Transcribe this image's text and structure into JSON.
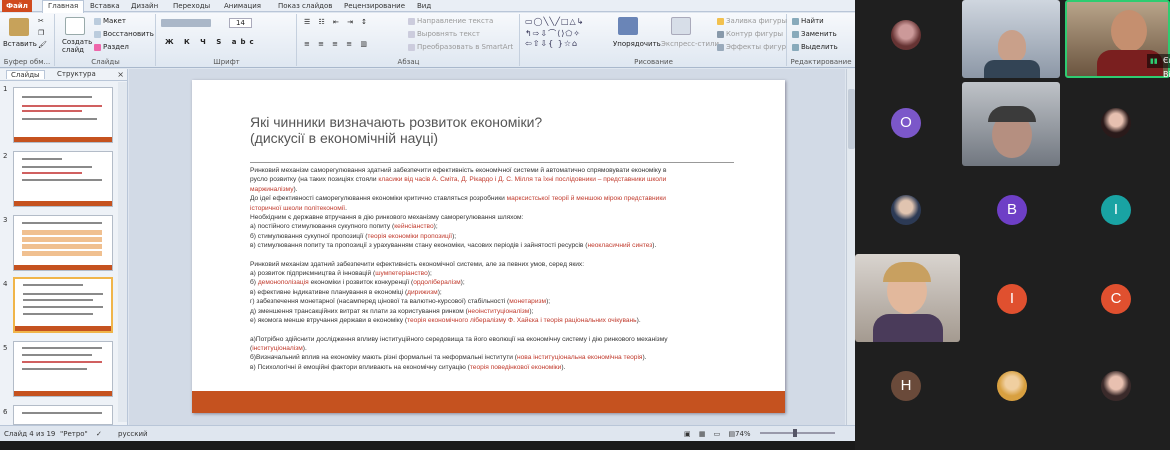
{
  "ribbon": {
    "file_tab": "Файл",
    "tabs": [
      "Главная",
      "Вставка",
      "Дизайн",
      "Переходы",
      "Анимация",
      "Показ слайдов",
      "Рецензирование",
      "Вид"
    ],
    "groups": {
      "clipboard": "Буфер обм...",
      "slides": "Слайды",
      "font": "Шрифт",
      "paragraph": "Абзац",
      "drawing": "Рисование",
      "editing": "Редактирование"
    },
    "paste": "Вставить",
    "new_slide": "Создать слайд",
    "layout": "Макет",
    "reset": "Восстановить",
    "section": "Раздел",
    "font_size": "14",
    "text_direction": "Направление текста",
    "align_text": "Выровнять текст",
    "smartart": "Преобразовать в SmartArt",
    "arrange": "Упорядочить",
    "quick_styles": "Экспресс-стили",
    "shape_fill": "Заливка фигуры",
    "shape_outline": "Контур фигуры",
    "shape_effects": "Эффекты фигур",
    "find": "Найти",
    "replace": "Заменить",
    "select": "Выделить"
  },
  "panel": {
    "tab_slides": "Слайды",
    "tab_outline": "Структура",
    "close": "×",
    "slide_numbers": [
      "1",
      "2",
      "3",
      "4",
      "5",
      "6"
    ]
  },
  "slide": {
    "title_line1": "Які чинники визначають розвиток економіки?",
    "title_line2": "(дискусії в економічній науці)",
    "p1a": "Ринковий механізм саморегулювання здатний забезпечити ефективність економічної системи й автоматично спрямовувати економіку в",
    "p1b_pre": "русло розвитку (на таких позиціях стояли ",
    "p1b_red": "класики від часів А. Сміта, Д. Рікардо і  Д. С. Мілля та їхні послідовники – представники школи",
    "p1c_red": "маржиналізму",
    "p1c_post": ").",
    "p2a_pre": "До  ідеї ефективності саморегулювання економіки критично ставляться розробники ",
    "p2a_red": "марксистської  теорії й меншою мірою представники",
    "p2b_red": "історичної школи політекономії",
    "p2b_post": ".",
    "p3": "Необхідним є державне втручання в дію ринкового механізму саморегулювання шляхом:",
    "p3a_pre": "а) постійного стимулювання сукупного попиту (",
    "p3a_red": "кейнсіанство",
    "p3a_post": ");",
    "p3b_pre": "б) стимулювання сукупної пропозиції (",
    "p3b_red": "теорія економіки пропозиції",
    "p3b_post": ");",
    "p3c_pre": "в) стимулювання  попиту та пропозиції з урахуванням стану економіки, часових періодів і зайнятості ресурсів (",
    "p3c_red": "неокласичний синтез",
    "p3c_post": ").",
    "p4": "Ринковий механізм здатний забезпечити ефективність економічної системи, але за певних умов, серед яких:",
    "p4a_pre": "а) розвиток підприємництва й інновацій (",
    "p4a_red": "шумпетеріанство",
    "p4a_post": ");",
    "p4b_pre": "б) ",
    "p4b_red1": "демонополізація",
    "p4b_mid": " економіки і розвиток конкуренції (",
    "p4b_red2": "ордолібералізм",
    "p4b_post": ");",
    "p4c_pre": "в) ефективне  індикативне планування в економіці (",
    "p4c_red": "дирижизм",
    "p4c_post": ");",
    "p4d_pre": "г) забезпечення монетарної (насамперед цінової та валютно-курсової) стабільності (",
    "p4d_red": "монетаризм",
    "p4d_post": ");",
    "p4e_pre": "д) зменшення трансакційних витрат як плати за користування ринком (",
    "p4e_red": "неоінституціоналізм",
    "p4e_post": ");",
    "p4f_pre": "е) якомога менше втручання держави в економіку (",
    "p4f_red": "теорія економічного лібералізму Ф. Хайєка і теорія раціональних очікувань",
    "p4f_post": ").",
    "p5a": "а)Потрібно здійснити дослідження впливу інституційного середовища та його еволюції на економічну систему і дію ринкового механізму",
    "p5a2_pre": "(",
    "p5a2_red": "інституціоналізм",
    "p5a2_post": ").",
    "p5b_pre": "б)Визначальний вплив на економіку мають різні формальні та неформальні інститути (",
    "p5b_red": "нова інституціональна економічна теорія",
    "p5b_post": ").",
    "p5c_pre": "в)  Психологічні й емоційні фактори впливають на економічну ситуацію (",
    "p5c_red": "теорія поведінкової економіки",
    "p5c_post": ")."
  },
  "status": {
    "slide_info": "Слайд 4 из 19",
    "theme": "\"Ретро\"",
    "language": "русский",
    "zoom": "74%"
  },
  "meeting": {
    "name_tag": "Євген Вікто...",
    "avatars": [
      {
        "letter": "O",
        "color": "#7b57c9"
      },
      {
        "letter": "B",
        "color": "#6e3fc6"
      },
      {
        "letter": "I",
        "color": "#19a3a3"
      },
      {
        "letter": "I",
        "color": "#e0502f"
      },
      {
        "letter": "C",
        "color": "#e0502f"
      },
      {
        "letter": "H",
        "color": "#6a4a3a"
      }
    ]
  },
  "colors": {
    "accent": "#c5521f",
    "red_text": "#c0392b"
  }
}
